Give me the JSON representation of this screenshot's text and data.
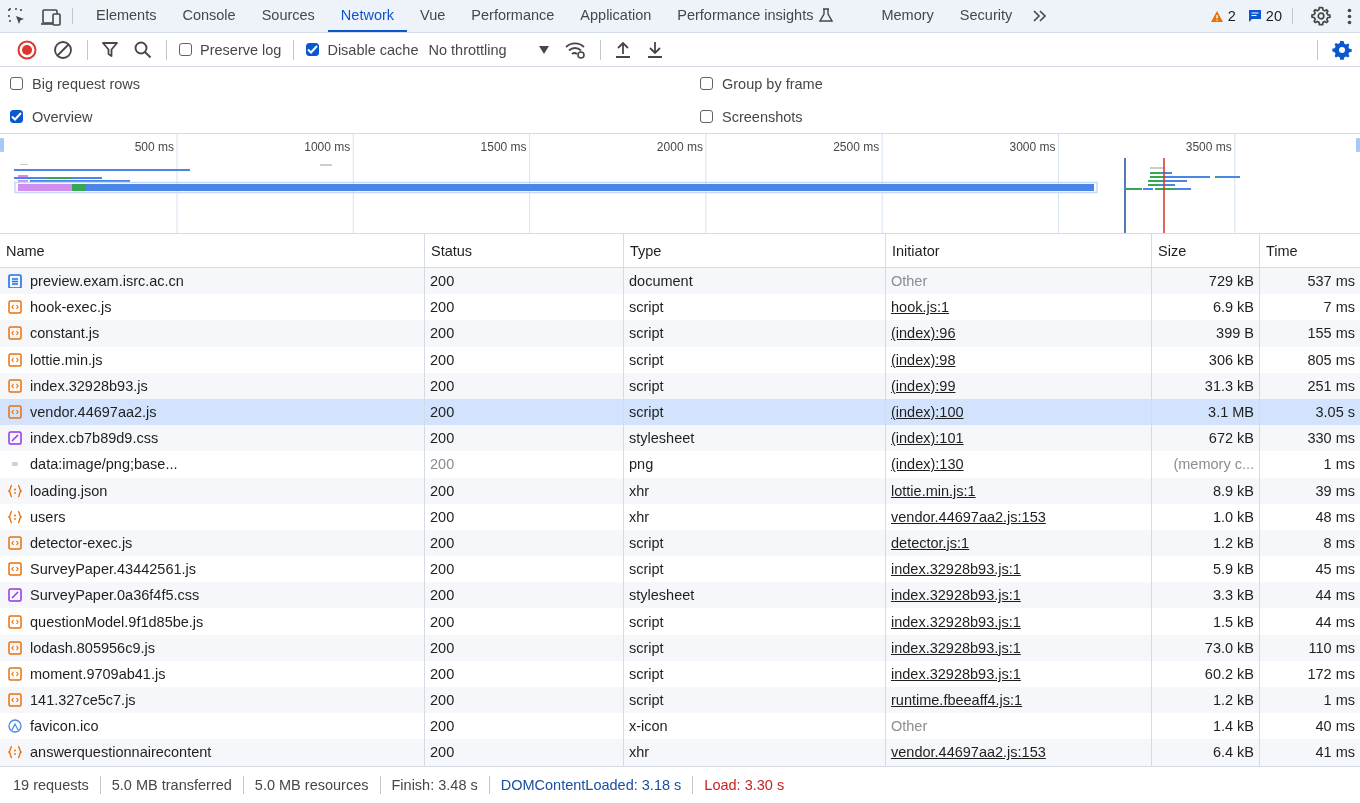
{
  "tabs": [
    {
      "label": "Elements",
      "selected": false
    },
    {
      "label": "Console",
      "selected": false
    },
    {
      "label": "Sources",
      "selected": false
    },
    {
      "label": "Network",
      "selected": true
    },
    {
      "label": "Vue",
      "selected": false
    },
    {
      "label": "Performance",
      "selected": false
    },
    {
      "label": "Application",
      "selected": false
    },
    {
      "label": "Performance insights",
      "selected": false,
      "experimental": true
    },
    {
      "label": "Memory",
      "selected": false
    },
    {
      "label": "Security",
      "selected": false
    }
  ],
  "issues": {
    "warnings": "2",
    "messages": "20"
  },
  "toolbar": {
    "recording": true,
    "preserve_log": {
      "label": "Preserve log",
      "checked": false
    },
    "disable_cache": {
      "label": "Disable cache",
      "checked": true
    },
    "throttling": "No throttling"
  },
  "settings": [
    {
      "label": "Big request rows",
      "checked": false
    },
    {
      "label": "Group by frame",
      "checked": false
    },
    {
      "label": "Overview",
      "checked": true
    },
    {
      "label": "Screenshots",
      "checked": false
    }
  ],
  "overview": {
    "ticks": [
      "500 ms",
      "1000 ms",
      "1500 ms",
      "2000 ms",
      "2500 ms",
      "3000 ms",
      "3500 ms"
    ]
  },
  "table": {
    "columns": [
      "Name",
      "Status",
      "Type",
      "Initiator",
      "Size",
      "Time"
    ],
    "rows": [
      {
        "kind": "document",
        "name": "preview.exam.isrc.ac.cn",
        "status": "200",
        "type": "document",
        "initiator": "Other",
        "initiator_link": false,
        "size": "729 kB",
        "time": "537 ms",
        "cached": false,
        "selected": false
      },
      {
        "kind": "script",
        "name": "hook-exec.js",
        "status": "200",
        "type": "script",
        "initiator": "hook.js:1",
        "initiator_link": true,
        "size": "6.9 kB",
        "time": "7 ms",
        "cached": false,
        "selected": false
      },
      {
        "kind": "script",
        "name": "constant.js",
        "status": "200",
        "type": "script",
        "initiator": "(index):96",
        "initiator_link": true,
        "size": "399 B",
        "time": "155 ms",
        "cached": false,
        "selected": false
      },
      {
        "kind": "script",
        "name": "lottie.min.js",
        "status": "200",
        "type": "script",
        "initiator": "(index):98",
        "initiator_link": true,
        "size": "306 kB",
        "time": "805 ms",
        "cached": false,
        "selected": false
      },
      {
        "kind": "script",
        "name": "index.32928b93.js",
        "status": "200",
        "type": "script",
        "initiator": "(index):99",
        "initiator_link": true,
        "size": "31.3 kB",
        "time": "251 ms",
        "cached": false,
        "selected": false
      },
      {
        "kind": "script",
        "name": "vendor.44697aa2.js",
        "status": "200",
        "type": "script",
        "initiator": "(index):100",
        "initiator_link": true,
        "size": "3.1 MB",
        "time": "3.05 s",
        "cached": false,
        "selected": true
      },
      {
        "kind": "stylesheet",
        "name": "index.cb7b89d9.css",
        "status": "200",
        "type": "stylesheet",
        "initiator": "(index):101",
        "initiator_link": true,
        "size": "672 kB",
        "time": "330 ms",
        "cached": false,
        "selected": false
      },
      {
        "kind": "image",
        "name": "data:image/png;base...",
        "status": "200",
        "type": "png",
        "initiator": "(index):130",
        "initiator_link": true,
        "size": "(memory c...",
        "time": "1 ms",
        "cached": true,
        "selected": false
      },
      {
        "kind": "json",
        "name": "loading.json",
        "status": "200",
        "type": "xhr",
        "initiator": "lottie.min.js:1",
        "initiator_link": true,
        "size": "8.9 kB",
        "time": "39 ms",
        "cached": false,
        "selected": false
      },
      {
        "kind": "json",
        "name": "users",
        "status": "200",
        "type": "xhr",
        "initiator": "vendor.44697aa2.js:153",
        "initiator_link": true,
        "size": "1.0 kB",
        "time": "48 ms",
        "cached": false,
        "selected": false
      },
      {
        "kind": "script",
        "name": "detector-exec.js",
        "status": "200",
        "type": "script",
        "initiator": "detector.js:1",
        "initiator_link": true,
        "size": "1.2 kB",
        "time": "8 ms",
        "cached": false,
        "selected": false
      },
      {
        "kind": "script",
        "name": "SurveyPaper.43442561.js",
        "status": "200",
        "type": "script",
        "initiator": "index.32928b93.js:1",
        "initiator_link": true,
        "size": "5.9 kB",
        "time": "45 ms",
        "cached": false,
        "selected": false
      },
      {
        "kind": "stylesheet",
        "name": "SurveyPaper.0a36f4f5.css",
        "status": "200",
        "type": "stylesheet",
        "initiator": "index.32928b93.js:1",
        "initiator_link": true,
        "size": "3.3 kB",
        "time": "44 ms",
        "cached": false,
        "selected": false
      },
      {
        "kind": "script",
        "name": "questionModel.9f1d85be.js",
        "status": "200",
        "type": "script",
        "initiator": "index.32928b93.js:1",
        "initiator_link": true,
        "size": "1.5 kB",
        "time": "44 ms",
        "cached": false,
        "selected": false
      },
      {
        "kind": "script",
        "name": "lodash.805956c9.js",
        "status": "200",
        "type": "script",
        "initiator": "index.32928b93.js:1",
        "initiator_link": true,
        "size": "73.0 kB",
        "time": "110 ms",
        "cached": false,
        "selected": false
      },
      {
        "kind": "script",
        "name": "moment.9709ab41.js",
        "status": "200",
        "type": "script",
        "initiator": "index.32928b93.js:1",
        "initiator_link": true,
        "size": "60.2 kB",
        "time": "172 ms",
        "cached": false,
        "selected": false
      },
      {
        "kind": "script",
        "name": "141.327ce5c7.js",
        "status": "200",
        "type": "script",
        "initiator": "runtime.fbeeaff4.js:1",
        "initiator_link": true,
        "size": "1.2 kB",
        "time": "1 ms",
        "cached": false,
        "selected": false
      },
      {
        "kind": "favicon",
        "name": "favicon.ico",
        "status": "200",
        "type": "x-icon",
        "initiator": "Other",
        "initiator_link": false,
        "size": "1.4 kB",
        "time": "40 ms",
        "cached": false,
        "selected": false
      },
      {
        "kind": "json",
        "name": "answerquestionnairecontent",
        "status": "200",
        "type": "xhr",
        "initiator": "vendor.44697aa2.js:153",
        "initiator_link": true,
        "size": "6.4 kB",
        "time": "41 ms",
        "cached": false,
        "selected": false
      }
    ]
  },
  "status_bar": [
    {
      "text": "19 requests",
      "kind": "plain"
    },
    {
      "text": "5.0 MB transferred",
      "kind": "plain"
    },
    {
      "text": "5.0 MB resources",
      "kind": "plain"
    },
    {
      "text": "Finish: 3.48 s",
      "kind": "plain"
    },
    {
      "text": "DOMContentLoaded: 3.18 s",
      "kind": "dcl"
    },
    {
      "text": "Load: 3.30 s",
      "kind": "load"
    }
  ]
}
